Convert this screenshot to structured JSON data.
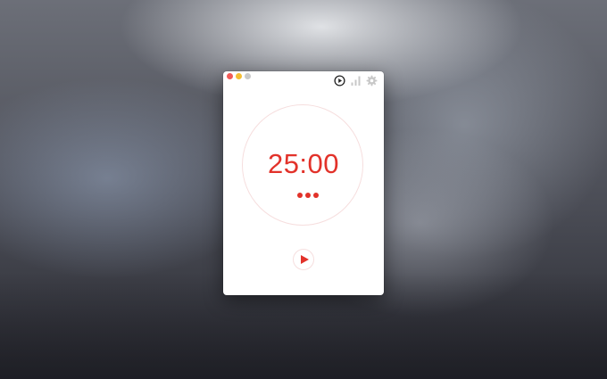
{
  "window": {
    "traffic_lights": [
      {
        "name": "close",
        "color": "#f25b57"
      },
      {
        "name": "minimize",
        "color": "#f5be33"
      },
      {
        "name": "zoom",
        "color": "#c9c9c9"
      }
    ],
    "toolbar": {
      "timer_icon": "play-circle-icon",
      "stats_icon": "bar-chart-icon",
      "settings_icon": "gear-icon",
      "active_color": "#222222",
      "inactive_color": "#c8c8c8"
    }
  },
  "timer": {
    "time_display": "25:00",
    "completed_sessions": 3,
    "accent_color": "#e2322a",
    "dial_color": "#f6dede",
    "play_button_icon": "play-icon"
  }
}
